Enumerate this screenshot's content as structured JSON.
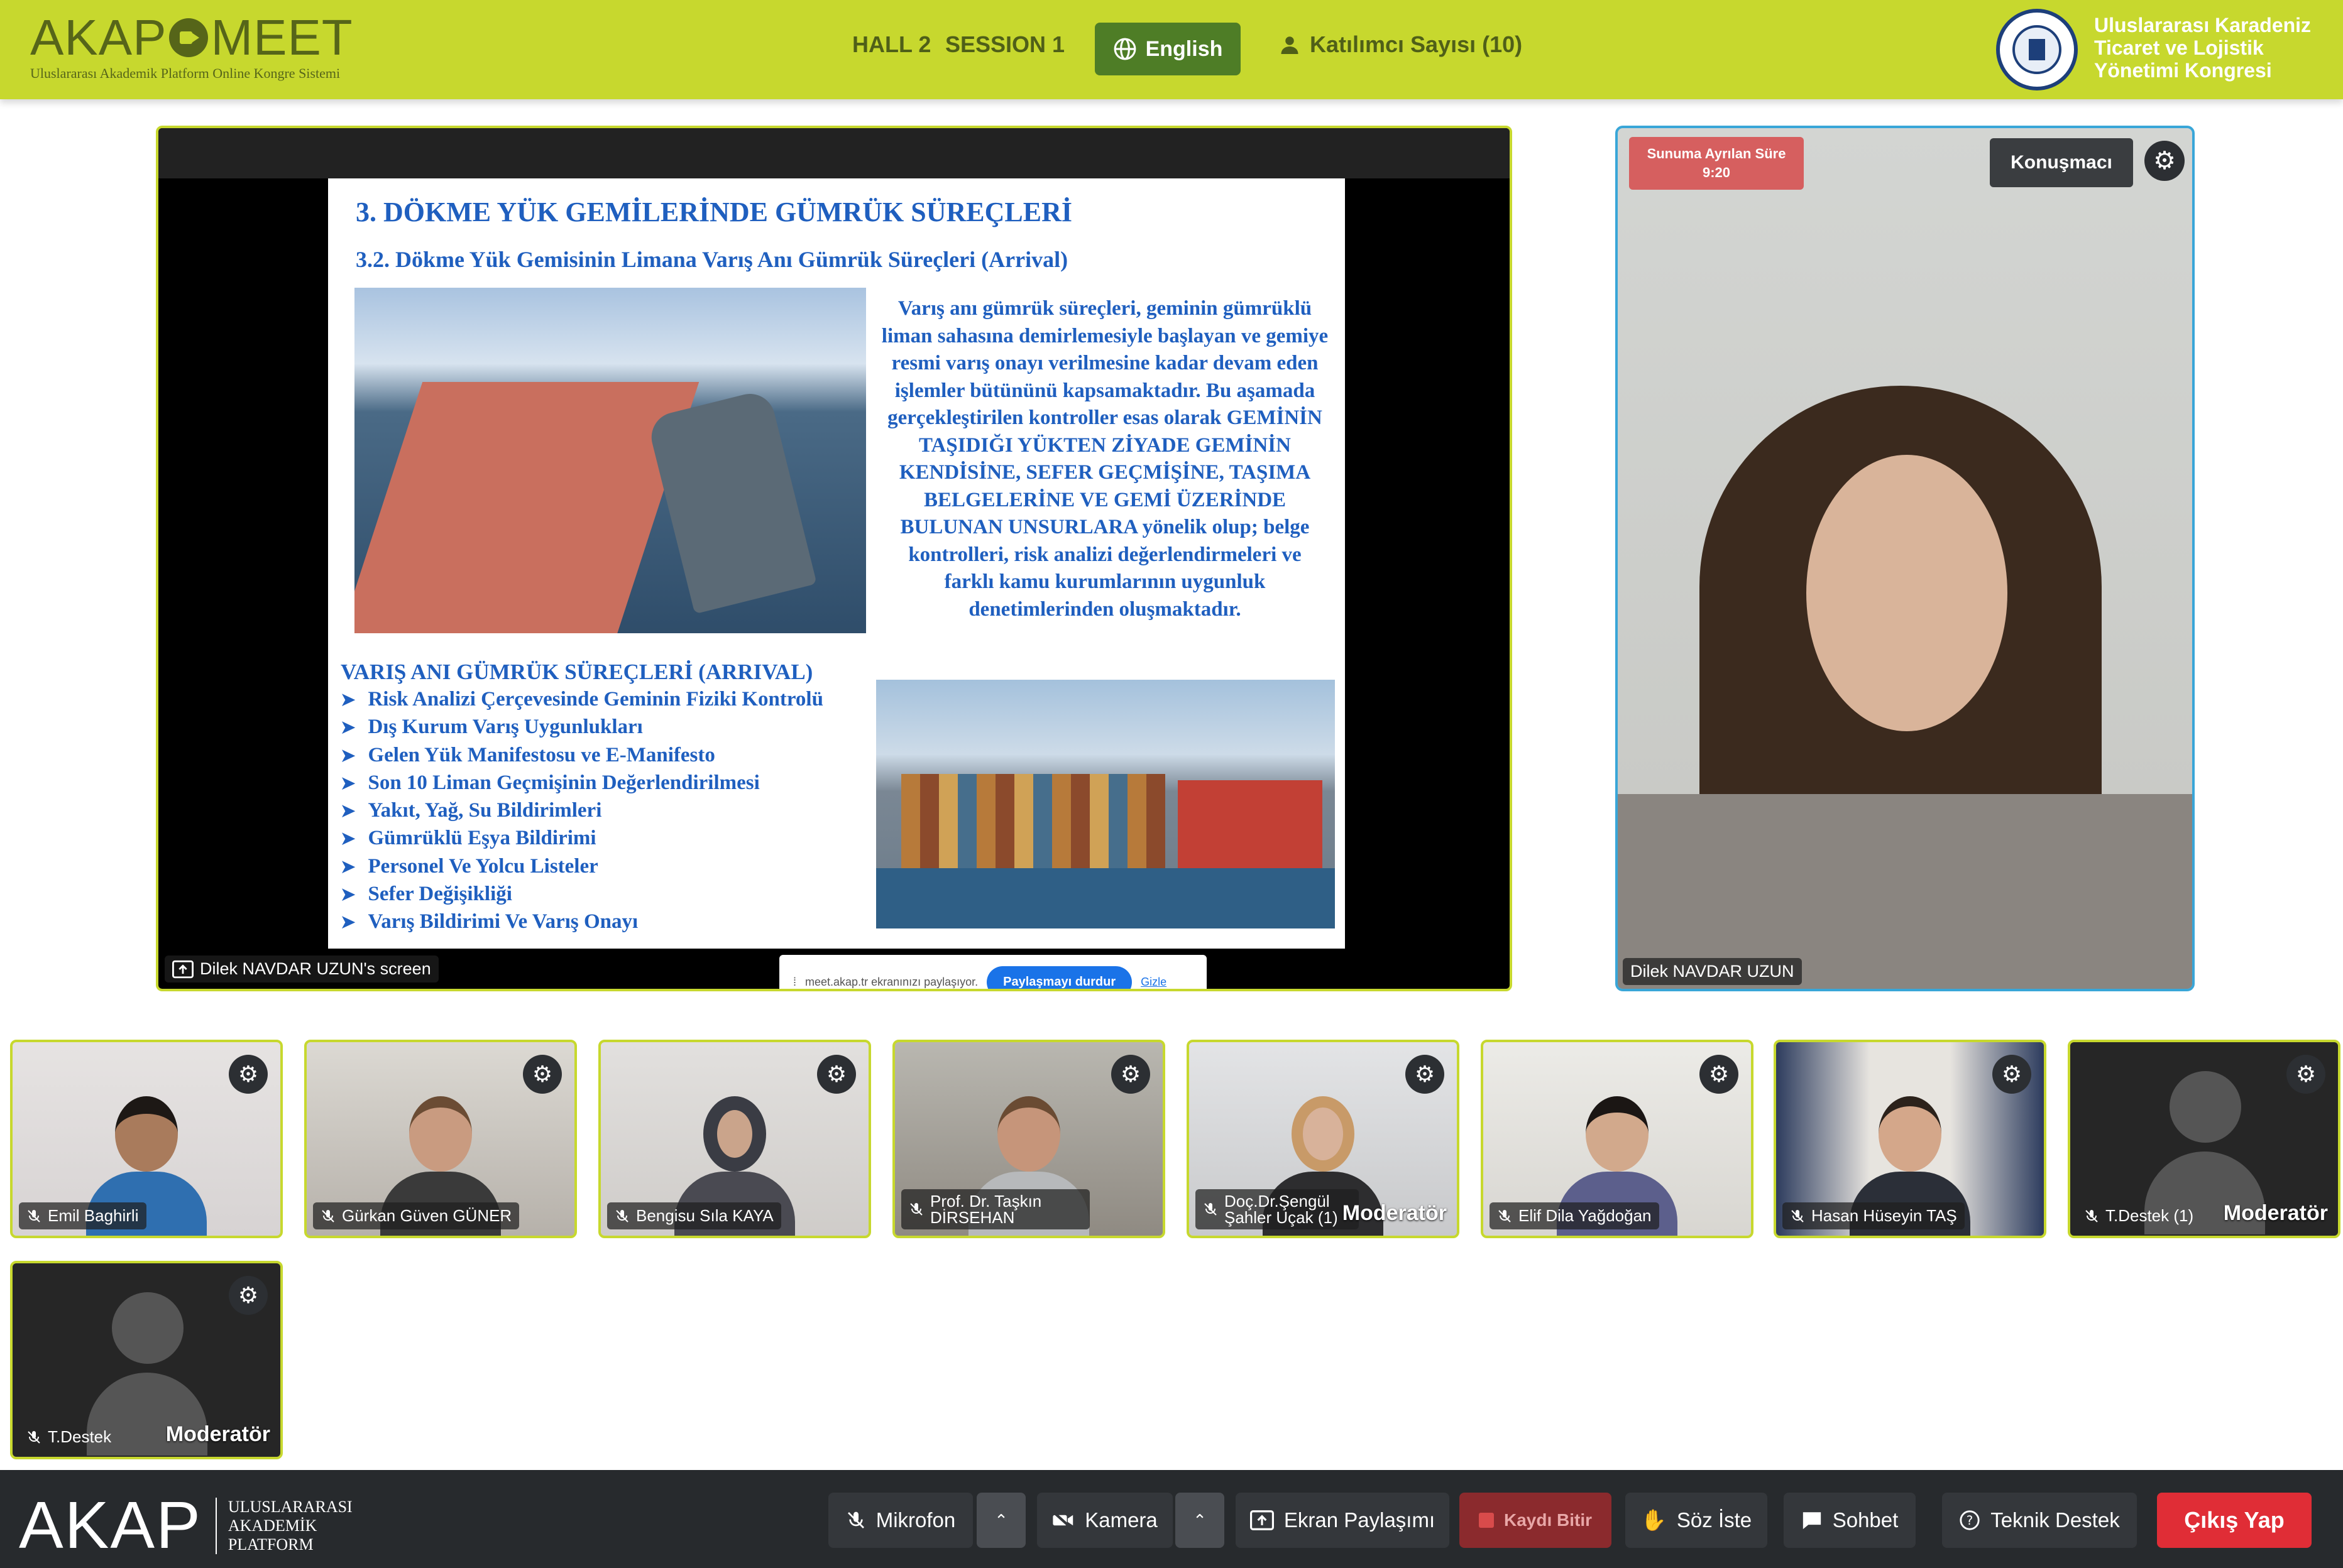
{
  "header": {
    "logo": {
      "brand_pre": "AKAP",
      "brand_post": "MEET",
      "tagline": "Uluslararası Akademik Platform Online Kongre Sistemi"
    },
    "hall": "HALL 2",
    "session": "SESSION 1",
    "language_label": "English",
    "participants_label": "Katılımcı Sayısı (10)",
    "congress_title_lines": [
      "Uluslararası Karadeniz",
      "Ticaret ve Lojistik",
      "Yönetimi Kongresi"
    ]
  },
  "screen_share": {
    "label": "Dilek NAVDAR UZUN's screen",
    "slide": {
      "title": "3. DÖKME YÜK GEMİLERİNDE GÜMRÜK SÜREÇLERİ",
      "subtitle": "3.2. Dökme Yük Gemisinin Limana Varış Anı Gümrük Süreçleri (Arrival)",
      "paragraph": "Varış anı gümrük süreçleri, geminin gümrüklü liman sahasına demirlemesiyle başlayan ve gemiye resmi varış onayı verilmesine kadar devam eden işlemler bütününü kapsamaktadır. Bu aşamada gerçekleştirilen kontroller esas olarak GEMİNİN TAŞIDIĞI YÜKTEN ZİYADE GEMİNİN KENDİSİNE, SEFER GEÇMİŞİNE, TAŞIMA BELGELERİNE VE GEMİ ÜZERİNDE BULUNAN UNSURLARA yönelik olup; belge kontrolleri, risk analizi değerlendirmeleri ve farklı kamu kurumlarının uygunluk denetimlerinden oluşmaktadır.",
      "list_heading": "VARIŞ ANI GÜMRÜK SÜREÇLERİ (ARRIVAL)",
      "list_items": [
        "Risk Analizi Çerçevesinde Geminin Fiziki Kontrolü",
        "Dış Kurum Varış Uygunlukları",
        "Gelen Yük Manifestosu ve E-Manifesto",
        "Son 10 Liman Geçmişinin Değerlendirilmesi",
        "Yakıt, Yağ, Su Bildirimleri",
        "Gümrüklü Eşya Bildirimi",
        "Personel Ve Yolcu Listeler",
        "Sefer Değişikliği",
        "Varış Bildirimi Ve Varış Onayı"
      ]
    },
    "share_popup": {
      "message": "meet.akap.tr ekranınızı paylaşıyor.",
      "stop_label": "Paylaşmayı durdur",
      "hide_label": "Gizle"
    }
  },
  "speaker": {
    "timer_label": "Sunuma Ayrılan Süre",
    "timer_value": "9:20",
    "badge": "Konuşmacı",
    "name": "Dilek NAVDAR UZUN"
  },
  "participants": [
    {
      "name": "Emil Baghirli",
      "moderator": ""
    },
    {
      "name": "Gürkan Güven GÜNER",
      "moderator": ""
    },
    {
      "name": "Bengisu Sıla KAYA",
      "moderator": ""
    },
    {
      "name": "Prof. Dr. Taşkın DİRSEHAN",
      "moderator": ""
    },
    {
      "name": "Doç.Dr.Şengül Şahler Uçak (1)",
      "moderator": "Moderatör"
    },
    {
      "name": "Elif Dila Yağdoğan",
      "moderator": ""
    },
    {
      "name": "Hasan Hüseyin TAŞ",
      "moderator": ""
    },
    {
      "name": "T.Destek (1)",
      "moderator": "Moderatör"
    },
    {
      "name": "T.Destek",
      "moderator": "Moderatör"
    }
  ],
  "footer": {
    "logo_text": "AKAP",
    "logo_sub_lines": [
      "ULUSLARARASI",
      "AKADEMİK",
      "PLATFORM"
    ],
    "mic_label": "Mikrofon",
    "camera_label": "Kamera",
    "share_label": "Ekran Paylaşımı",
    "record_label": "Kaydı Bitir",
    "raise_hand_label": "Söz İste",
    "chat_label": "Sohbet",
    "support_label": "Teknik Destek",
    "exit_label": "Çıkış Yap"
  },
  "colors": {
    "header_bg": "#c7d82e",
    "active_border": "#39a6d8",
    "exit": "#e02d36",
    "record": "#8b2a2d"
  }
}
